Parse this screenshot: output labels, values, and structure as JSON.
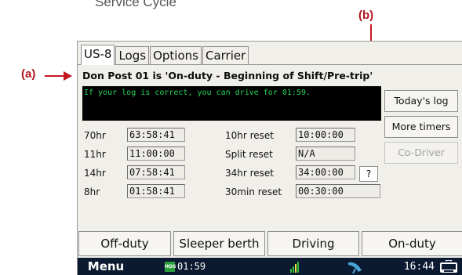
{
  "caption": "Service Cycle",
  "callouts": {
    "a": "(a)",
    "b": "(b)"
  },
  "tabs": [
    "US-8",
    "Logs",
    "Options",
    "Carrier"
  ],
  "status_line": "Don Post 01 is 'On-duty - Beginning of Shift/Pre-trip'",
  "drive_message": "If your log is correct, you can drive for 01:59.",
  "side_buttons": {
    "todays_log": "Today's log",
    "more_timers": "More timers",
    "co_driver": "Co-Driver"
  },
  "timers": {
    "left": [
      {
        "label": "70hr",
        "value": "63:58:41"
      },
      {
        "label": "11hr",
        "value": "11:00:00"
      },
      {
        "label": "14hr",
        "value": "07:58:41"
      },
      {
        "label": "8hr",
        "value": "01:58:41"
      }
    ],
    "right": [
      {
        "label": "10hr reset",
        "value": "10:00:00"
      },
      {
        "label": "Split reset",
        "value": "N/A"
      },
      {
        "label": "34hr reset",
        "value": "34:00:00"
      },
      {
        "label": "30min reset",
        "value": "00:30:00"
      }
    ],
    "help_button": "?"
  },
  "duty_buttons": [
    "Off-duty",
    "Sleeper berth",
    "Driving",
    "On-duty"
  ],
  "taskbar": {
    "menu": "Menu",
    "hos_badge": "HOS",
    "hos_time": "01:59",
    "clock": "16:44"
  },
  "colors": {
    "accent_red": "#c41820",
    "drive_text": "#25d35a",
    "taskbar": "#0b1a30"
  },
  "icons": [
    "signal-strength-icon",
    "satellite-dish-icon",
    "keyboard-icon"
  ]
}
